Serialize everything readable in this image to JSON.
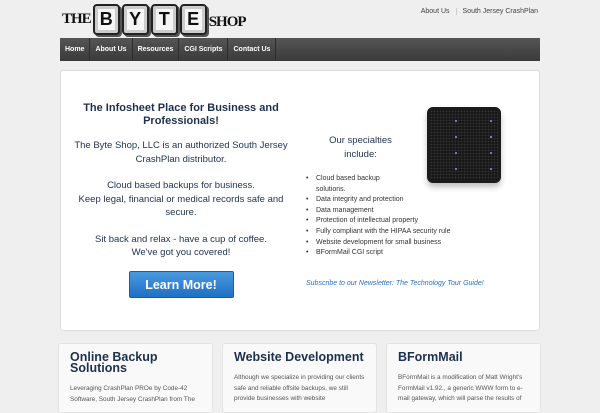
{
  "logo": {
    "the": "THE",
    "letters": [
      "B",
      "Y",
      "T",
      "E"
    ],
    "shop": "SHOP"
  },
  "toplinks": [
    "About Us",
    "South Jersey CrashPlan"
  ],
  "nav": [
    "Home",
    "About Us",
    "Resources",
    "CGI Scripts",
    "Contact Us"
  ],
  "hero": {
    "title": "The Infosheet Place for Business and Professionals!",
    "p1": "The Byte Shop, LLC is an authorized South Jersey CrashPlan distributor.",
    "p2a": "Cloud based backups for business.",
    "p2b": "Keep legal, financial or medical records safe and secure.",
    "p3a": "Sit back and relax - have a cup of coffee.",
    "p3b": "We've got you covered!",
    "button": "Learn More!",
    "specialties_title": "Our specialties include:",
    "specialties": [
      "Cloud based backup solutions.",
      "Data integrity and protection",
      "Data management",
      "Protection of intellectual property",
      "Fully compliant with the HIPAA security rule",
      "Website development for small business",
      "BFormMail CGI script"
    ],
    "newsletter": "Subscribe to our Newsletter: The Technology Tour Guide!"
  },
  "cards": [
    {
      "title": "Online Backup Solutions",
      "text": "Leveraging CrashPlan PROe by Code-42 Software, South Jersey CrashPlan from The"
    },
    {
      "title": "Website Development",
      "text": "Although we specialize in providing our clients safe and reliable offsite backups, we still provide businesses with website"
    },
    {
      "title": "BFormMail",
      "text": "BFormMail is a modification of Matt Wright's FormMail v1.92., a generic WWW form to e-mail gateway, which will parse the results of"
    }
  ]
}
